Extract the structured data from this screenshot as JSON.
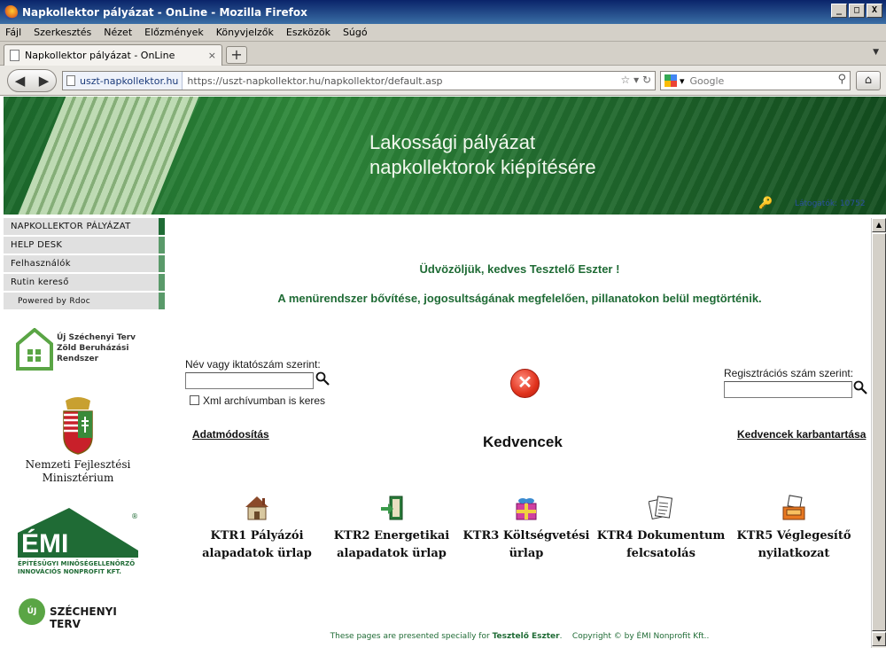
{
  "window": {
    "title": "Napkollektor pályázat - OnLine - Mozilla Firefox",
    "min": "_",
    "max": "□",
    "close": "X"
  },
  "menu": [
    "Fájl",
    "Szerkesztés",
    "Nézet",
    "Előzmények",
    "Könyvjelzők",
    "Eszközök",
    "Súgó"
  ],
  "tab": {
    "label": "Napkollektor pályázat - OnLine",
    "close": "×",
    "new": "+"
  },
  "nav": {
    "identity": "uszt-napkollektor.hu",
    "url": "https://uszt-napkollektor.hu/napkollektor/default.asp",
    "search_placeholder": "Google"
  },
  "banner": {
    "title_line1": "Lakossági pályázat",
    "title_line2": "napkollektorok kiépítésére",
    "visitors": "Látogatók: 10752"
  },
  "sidebar": {
    "items": [
      "NAPKOLLEKTOR PÁLYÁZAT",
      "HELP DESK",
      "Felhasználók",
      "Rutin kereső"
    ],
    "powered": "Powered by Rdoc"
  },
  "logos": {
    "ujszt": [
      "Új Széchenyi Terv",
      "Zöld Beruházási",
      "Rendszer"
    ],
    "nfm": [
      "Nemzeti Fejlesztési",
      "Minisztérium"
    ],
    "emi": [
      "ÉPÍTÉSÜGYI MINŐSÉGELLENŐRZŐ",
      "INNOVÁCIÓS NONPROFIT KFT."
    ],
    "szt": {
      "badge": "ÚJ",
      "text": "SZÉCHENYI TERV"
    }
  },
  "main": {
    "welcome": "Üdvözöljük, kedves Tesztelő Eszter !",
    "notice": "A menürendszer bővítése, jogosultságának megfelelően, pillanatokon belül megtörténik.",
    "search_name_label": "Név vagy iktatószám szerint:",
    "search_reg_label": "Regisztrációs szám szerint:",
    "xml_label": "Xml archívumban is keres",
    "link_edit": "Adatmódosítás",
    "favorites_title": "Kedvencek",
    "link_favorites": "Kedvencek karbantartása",
    "ktr": [
      {
        "line1": "KTR1 Pályázói",
        "line2": "alapadatok ürlap"
      },
      {
        "line1": "KTR2 Energetikai",
        "line2": "alapadatok ürlap"
      },
      {
        "line1": "KTR3 Költségvetési",
        "line2": "ürlap"
      },
      {
        "line1": "KTR4 Dokumentum",
        "line2": "felcsatolás"
      },
      {
        "line1": "KTR5 Véglegesítő",
        "line2": "nyilatkozat"
      }
    ]
  },
  "footer": {
    "prefix": "These pages are presented specially for",
    "user": "Tesztelő Eszter",
    "copyright": "Copyright © by ÉMI Nonprofit Kft.."
  },
  "colors": {
    "accent": "#1f6b35",
    "banner": "#236f30"
  }
}
